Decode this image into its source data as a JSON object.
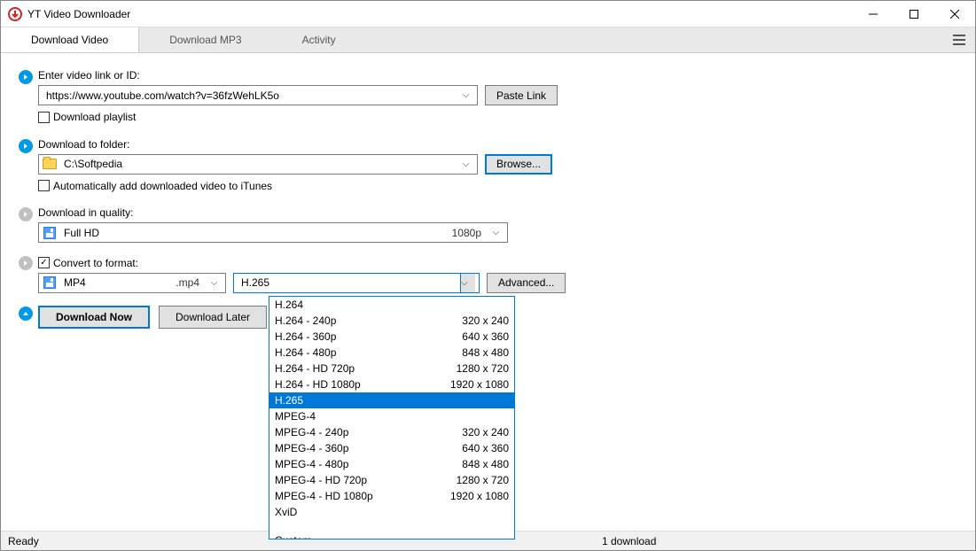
{
  "app": {
    "title": "YT Video Downloader"
  },
  "tabs": [
    "Download Video",
    "Download MP3",
    "Activity"
  ],
  "sections": {
    "video_link": {
      "label": "Enter video link or ID:",
      "value": "https://www.youtube.com/watch?v=36fzWehLK5o",
      "paste_button": "Paste Link",
      "playlist_checkbox": "Download playlist"
    },
    "folder": {
      "label": "Download to folder:",
      "value": "C:\\Softpedia",
      "browse_button": "Browse...",
      "itunes_checkbox": "Automatically add downloaded video to iTunes"
    },
    "quality": {
      "label": "Download in quality:",
      "name": "Full HD",
      "resolution": "1080p"
    },
    "convert": {
      "label": "Convert to format:",
      "format_name": "MP4",
      "format_ext": ".mp4",
      "encoder": "H.265",
      "advanced_button": "Advanced..."
    },
    "actions": {
      "download_now": "Download Now",
      "download_later": "Download Later"
    }
  },
  "dropdown": {
    "items": [
      {
        "name": "H.264",
        "res": ""
      },
      {
        "name": "H.264 - 240p",
        "res": "320 x 240"
      },
      {
        "name": "H.264 - 360p",
        "res": "640 x 360"
      },
      {
        "name": "H.264 - 480p",
        "res": "848 x 480"
      },
      {
        "name": "H.264 - HD 720p",
        "res": "1280 x 720"
      },
      {
        "name": "H.264 - HD 1080p",
        "res": "1920 x 1080"
      },
      {
        "name": "H.265",
        "res": "",
        "selected": true
      },
      {
        "name": "MPEG-4",
        "res": ""
      },
      {
        "name": "MPEG-4 - 240p",
        "res": "320 x 240"
      },
      {
        "name": "MPEG-4 - 360p",
        "res": "640 x 360"
      },
      {
        "name": "MPEG-4 - 480p",
        "res": "848 x 480"
      },
      {
        "name": "MPEG-4 - HD 720p",
        "res": "1280 x 720"
      },
      {
        "name": "MPEG-4 - HD 1080p",
        "res": "1920 x 1080"
      },
      {
        "name": "XviD",
        "res": ""
      },
      {
        "gap": true
      },
      {
        "name": "Custom",
        "res": ""
      }
    ]
  },
  "statusbar": {
    "left": "Ready",
    "right": "1 download"
  }
}
